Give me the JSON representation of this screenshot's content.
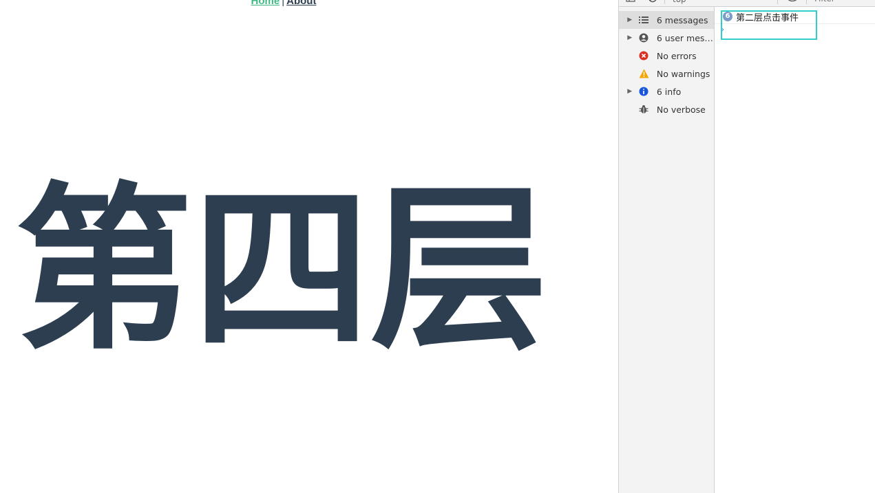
{
  "nav": {
    "home_label": "Home",
    "separator": "|",
    "about_label": "About"
  },
  "page": {
    "title": "第四层"
  },
  "devtools": {
    "toolbar": {
      "context": "top",
      "filter_placeholder": "Filter"
    },
    "sidebar": {
      "items": [
        {
          "label": "6 messages",
          "icon": "list-icon",
          "expandable": true,
          "selected": true
        },
        {
          "label": "6 user messages",
          "icon": "user-circle-icon",
          "expandable": true,
          "selected": false
        },
        {
          "label": "No errors",
          "icon": "error-icon",
          "expandable": false,
          "selected": false
        },
        {
          "label": "No warnings",
          "icon": "warning-icon",
          "expandable": false,
          "selected": false
        },
        {
          "label": "6 info",
          "icon": "info-icon",
          "expandable": true,
          "selected": false
        },
        {
          "label": "No verbose",
          "icon": "bug-icon",
          "expandable": false,
          "selected": false
        }
      ]
    },
    "console": {
      "messages": [
        {
          "count": "6",
          "text": "第二层点击事件"
        }
      ],
      "prompt_symbol": "›"
    }
  },
  "colors": {
    "title": "#2c3e50",
    "home_link": "#42b983",
    "error": "#d93025",
    "warning": "#f2a600",
    "info": "#1a56db",
    "highlight": "#33cccc"
  }
}
